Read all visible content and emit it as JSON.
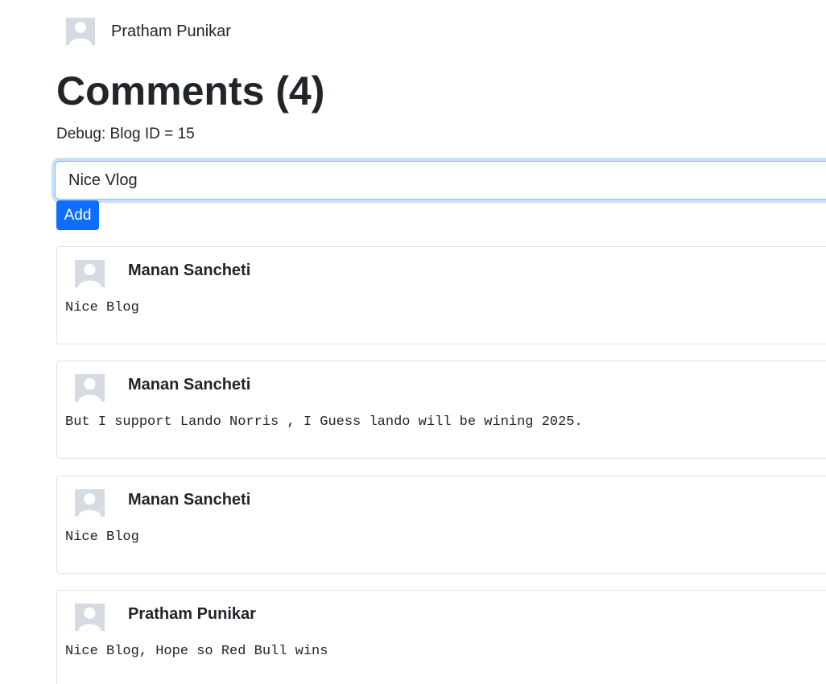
{
  "current_user": {
    "name": "Pratham Punikar"
  },
  "comments_section": {
    "heading": "Comments (4)",
    "debug_text": "Debug: Blog ID = 15"
  },
  "new_comment": {
    "value": "Nice Vlog",
    "add_label": "Add"
  },
  "comments": [
    {
      "author": "Manan Sancheti",
      "text": "Nice Blog"
    },
    {
      "author": "Manan Sancheti",
      "text": "But I support Lando Norris , I Guess lando will be wining 2025."
    },
    {
      "author": "Manan Sancheti",
      "text": "Nice Blog"
    },
    {
      "author": "Pratham Punikar",
      "text": "Nice Blog, Hope so Red Bull wins"
    }
  ],
  "colors": {
    "primary": "#0d6efd",
    "avatar_bg": "#d6dae3",
    "avatar_fg": "#ffffff",
    "border": "#dee2e6",
    "text": "#212529"
  }
}
